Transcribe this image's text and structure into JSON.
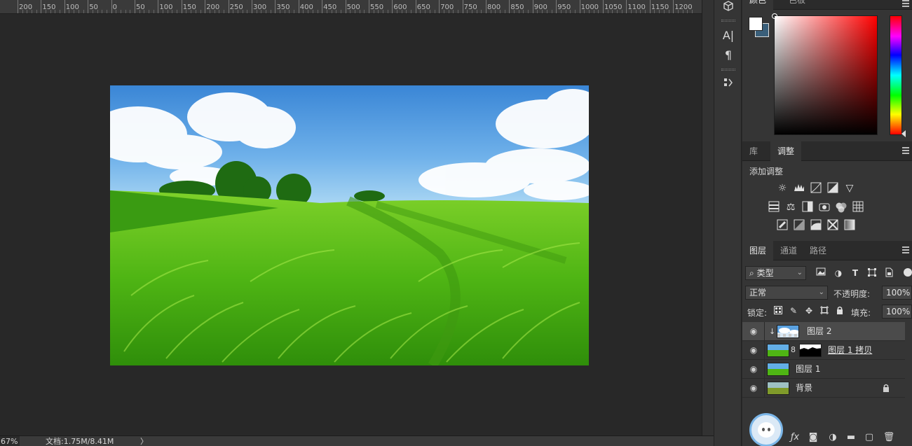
{
  "ruler": {
    "labels": [
      "200",
      "150",
      "100",
      "50",
      "0",
      "50",
      "100",
      "150",
      "200",
      "250",
      "300",
      "350",
      "400",
      "450",
      "500",
      "550",
      "600",
      "650",
      "700",
      "750",
      "800",
      "850",
      "900",
      "950",
      "1000",
      "1050",
      "1100",
      "1150",
      "1200"
    ]
  },
  "status": {
    "zoom": "67%",
    "doc": "文档:1.75M/8.41M",
    "arrow": "〉"
  },
  "colors": {
    "foreground": "#ffffff",
    "background": "#3a5f7a",
    "picker_hue": "#ff0000"
  },
  "color_panel": {
    "tabs": [
      "颜色",
      "色板"
    ]
  },
  "adjust_panel": {
    "tabs": [
      "库",
      "调整"
    ],
    "title": "添加调整",
    "icons": [
      "brightness-icon",
      "levels-icon",
      "curves-icon",
      "exposure-icon",
      "vibrance-icon",
      "hue-saturation-icon",
      "color-balance-icon",
      "black-white-icon",
      "photo-filter-icon",
      "channel-mixer-icon",
      "color-lookup-icon",
      "invert-icon",
      "posterize-icon",
      "threshold-icon",
      "selective-color-icon",
      "gradient-map-icon"
    ]
  },
  "layers_panel": {
    "tabs": [
      "图层",
      "通道",
      "路径"
    ],
    "filter_label": "类型",
    "blend_mode": "正常",
    "opacity_label": "不透明度:",
    "opacity_value": "100%",
    "lock_label": "锁定:",
    "fill_label": "填充:",
    "fill_value": "100%",
    "layers": [
      {
        "name": "图层 2",
        "selected": true
      },
      {
        "name": "图层 1 拷贝",
        "selected": false
      },
      {
        "name": "图层 1",
        "selected": false
      },
      {
        "name": "背景",
        "selected": false,
        "locked": true
      }
    ]
  },
  "toolstrip": {
    "type_tool": "A|",
    "paragraph_tool": "¶"
  }
}
